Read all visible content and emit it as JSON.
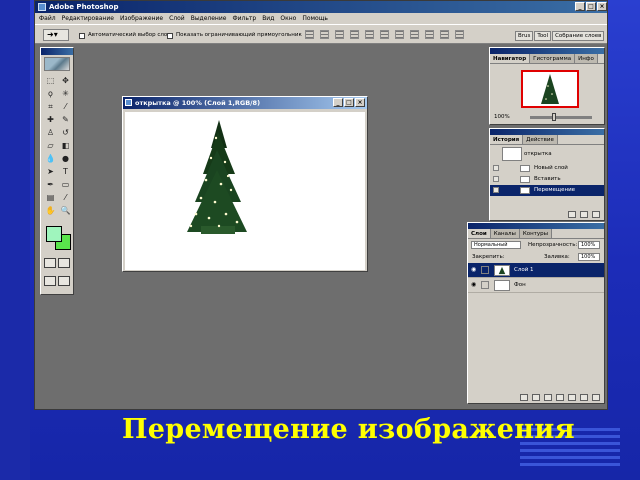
{
  "app": {
    "title": "Adobe Photoshop"
  },
  "menu": [
    "Файл",
    "Редактирование",
    "Изображение",
    "Слой",
    "Выделение",
    "Фильтр",
    "Вид",
    "Окно",
    "Помощь"
  ],
  "options": {
    "auto_select": "Автоматический выбор слоя",
    "show_bounds": "Показать ограничивающий прямоугольник"
  },
  "dock_tabs": [
    "Brus",
    "Tool",
    "Собрание слоев"
  ],
  "document": {
    "title": "открытка @ 100% (Слой 1,RGB/8)"
  },
  "navigator": {
    "tabs": [
      "Навигатор",
      "Гистограмма",
      "Инфо"
    ],
    "zoom": "100%"
  },
  "history": {
    "tabs": [
      "История",
      "Действие"
    ],
    "snapshot": "открытка",
    "items": [
      "Новый слой",
      "Вставить",
      "Перемещение"
    ]
  },
  "layers": {
    "tabs": [
      "Слои",
      "Каналы",
      "Контуры"
    ],
    "blend_mode": "Нормальный",
    "opacity_label": "Непрозрачность:",
    "opacity": "100%",
    "lock_label": "Закрепить:",
    "fill_label": "Заливка:",
    "fill": "100%",
    "items": [
      "Слой 1",
      "Фон"
    ]
  },
  "colors": {
    "foreground": "#9ff5bd",
    "background": "#59e64c",
    "selection": "#0a246a",
    "accent_caption": "#ffff00"
  },
  "caption": "Перемещение изображения"
}
